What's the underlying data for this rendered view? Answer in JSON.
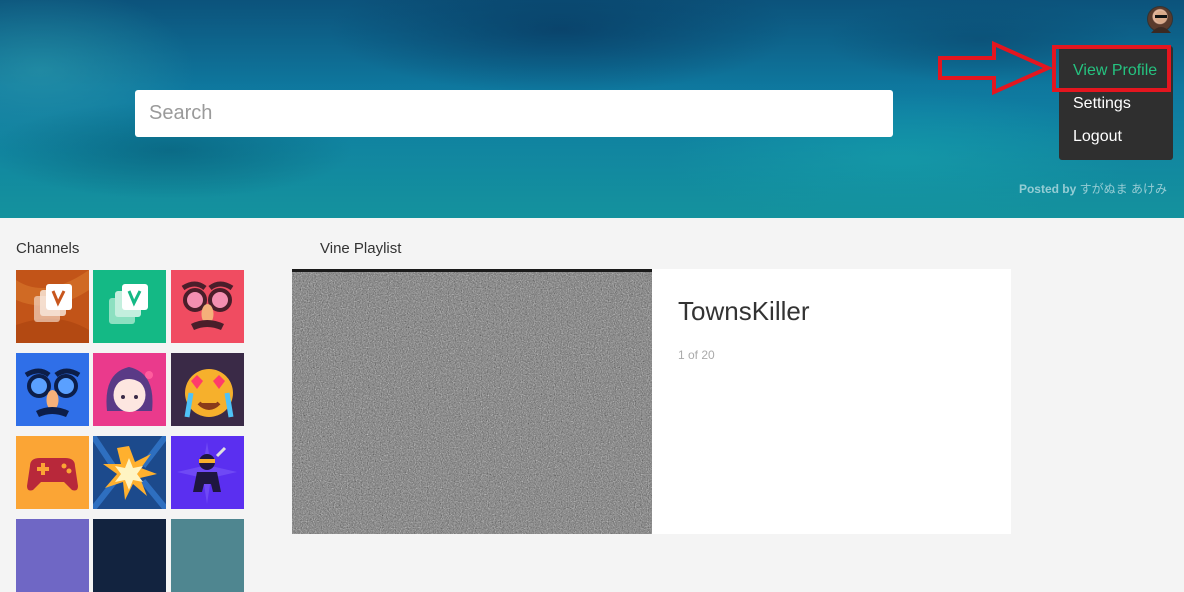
{
  "header": {
    "search_placeholder": "Search",
    "posted_by_label": "Posted by",
    "posted_by_name": "すがぬま あけみ"
  },
  "user_menu": {
    "avatar_icon": "user-avatar",
    "items": [
      {
        "label": "View Profile",
        "active": true
      },
      {
        "label": "Settings",
        "active": false
      },
      {
        "label": "Logout",
        "active": false
      }
    ],
    "highlight_color": "#e4161f",
    "active_color": "#25c380"
  },
  "channels": {
    "title": "Channels",
    "tiles": [
      {
        "icon": "vine-cards-icon",
        "bg": "#c8561d"
      },
      {
        "icon": "vine-cards-icon",
        "bg": "#14b985"
      },
      {
        "icon": "groucho-glasses-icon",
        "bg": "#f04c61"
      },
      {
        "icon": "groucho-glasses-icon",
        "bg": "#2f6fe8"
      },
      {
        "icon": "anime-girl-icon",
        "bg": "#ea3a8c"
      },
      {
        "icon": "heart-eyes-crying-icon",
        "bg": "#3a2a47"
      },
      {
        "icon": "gamepad-icon",
        "bg": "#fba535"
      },
      {
        "icon": "explosion-icon",
        "bg": "#1c4a8c"
      },
      {
        "icon": "ninja-icon",
        "bg": "#5b2ff0"
      },
      {
        "icon": "channel-icon",
        "bg": "#6f67c5"
      },
      {
        "icon": "channel-icon",
        "bg": "#12233f"
      },
      {
        "icon": "channel-icon",
        "bg": "#4f8690"
      }
    ]
  },
  "playlist": {
    "title": "Vine Playlist",
    "current": {
      "author": "TownsKiller",
      "position": "1 of 20"
    }
  }
}
